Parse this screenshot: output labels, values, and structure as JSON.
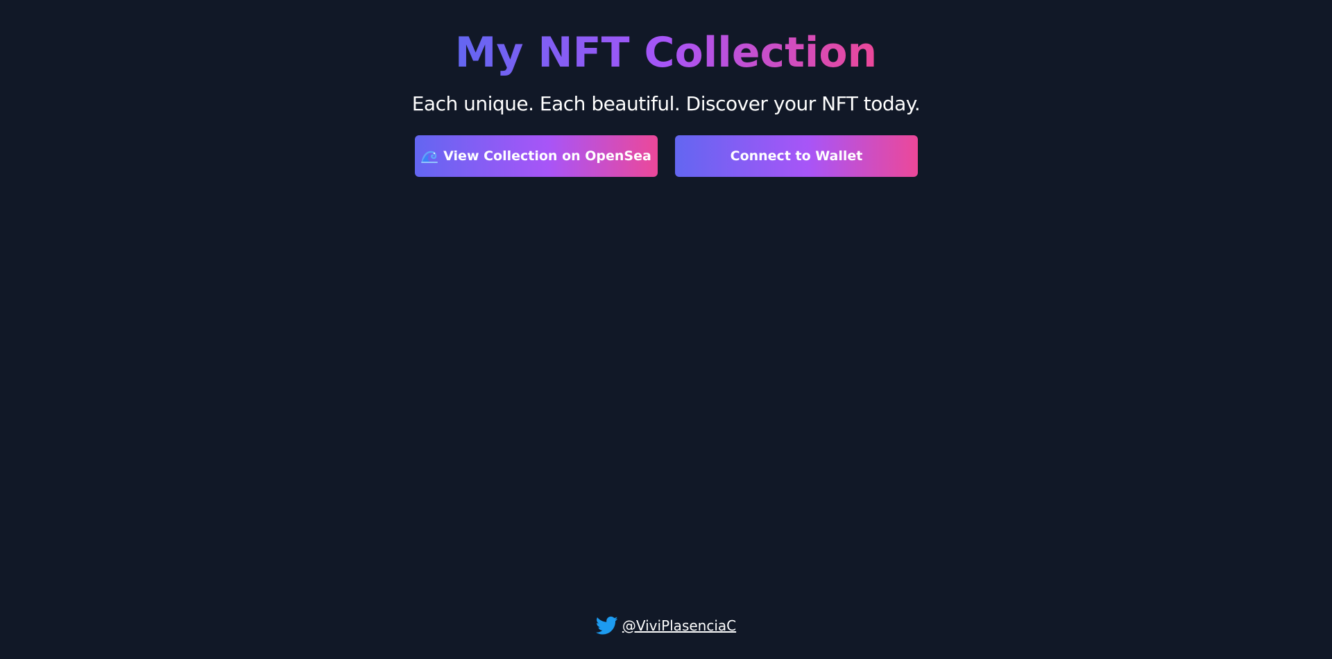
{
  "header": {
    "title": "My NFT Collection",
    "subtitle": "Each unique. Each beautiful. Discover your NFT today."
  },
  "actions": {
    "opensea_icon": "wave-icon",
    "opensea_label": "View Collection on OpenSea",
    "wallet_label": "Connect to Wallet"
  },
  "footer": {
    "icon": "twitter-icon",
    "twitter_handle": "@ViviPlasenciaC"
  },
  "colors": {
    "background": "#111827",
    "gradient_start": "#6366f1",
    "gradient_mid": "#a855f7",
    "gradient_end": "#ec4899",
    "twitter_blue": "#1d9bf0"
  }
}
